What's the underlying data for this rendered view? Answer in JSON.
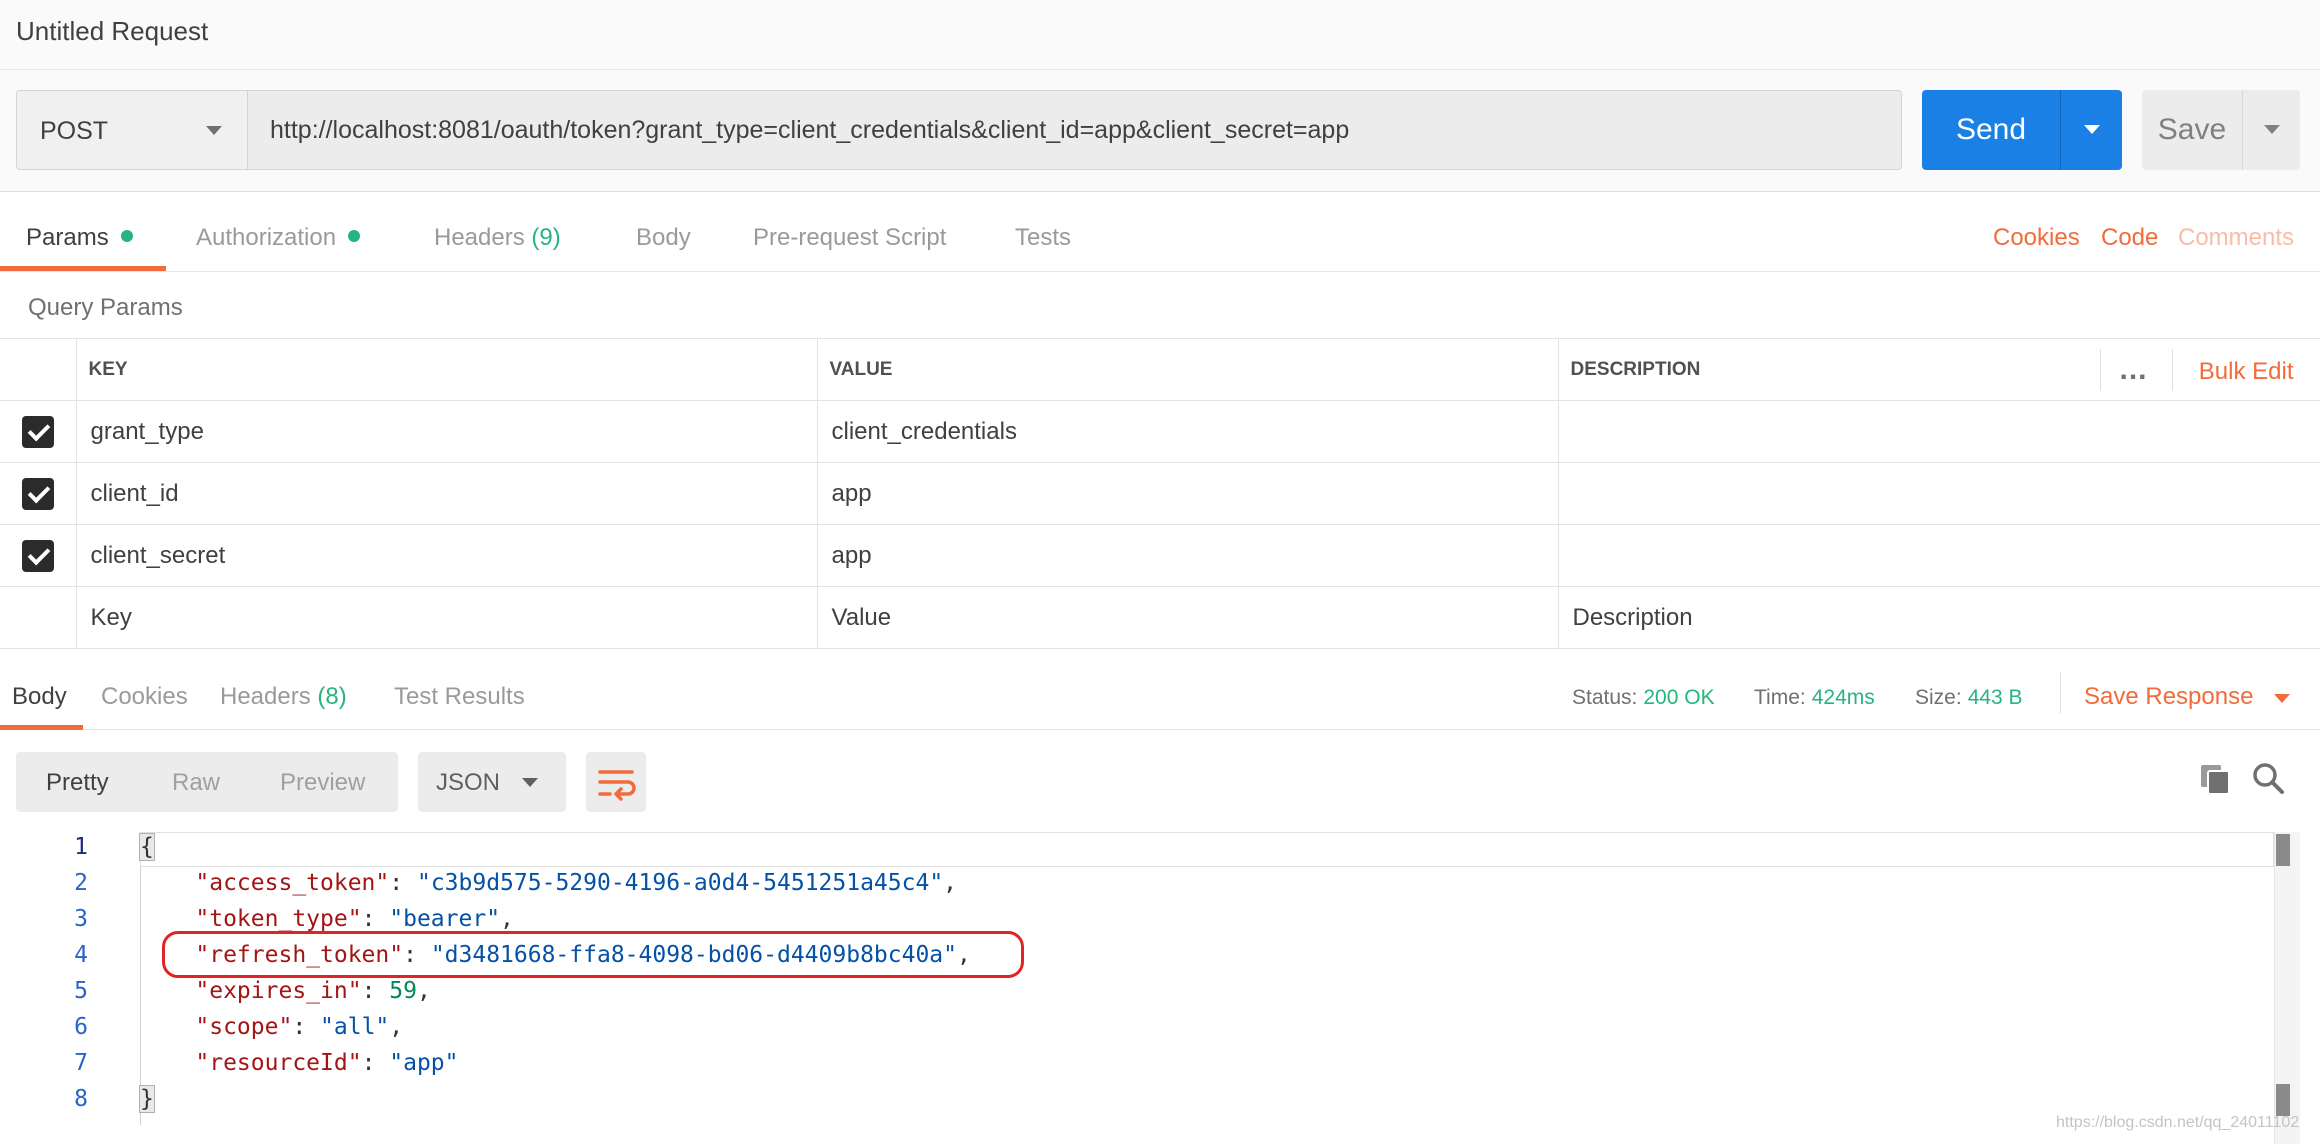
{
  "window": {
    "title": "Untitled Request"
  },
  "request": {
    "method": "POST",
    "url": "http://localhost:8081/oauth/token?grant_type=client_credentials&client_id=app&client_secret=app",
    "send_label": "Send",
    "save_label": "Save"
  },
  "request_tabs": {
    "params": "Params",
    "authorization": "Authorization",
    "headers": "Headers",
    "headers_count": "(9)",
    "body": "Body",
    "prerequest": "Pre-request Script",
    "tests": "Tests",
    "cookies": "Cookies",
    "code": "Code",
    "comments": "Comments"
  },
  "query_params": {
    "title": "Query Params",
    "columns": [
      "KEY",
      "VALUE",
      "DESCRIPTION"
    ],
    "more_icon": "...",
    "bulk_edit": "Bulk Edit",
    "rows": [
      {
        "checked": true,
        "key": "grant_type",
        "value": "client_credentials",
        "description": ""
      },
      {
        "checked": true,
        "key": "client_id",
        "value": "app",
        "description": ""
      },
      {
        "checked": true,
        "key": "client_secret",
        "value": "app",
        "description": ""
      }
    ],
    "placeholders": {
      "key": "Key",
      "value": "Value",
      "description": "Description"
    }
  },
  "response_tabs": {
    "body": "Body",
    "cookies": "Cookies",
    "headers": "Headers",
    "headers_count": "(8)",
    "test_results": "Test Results"
  },
  "response_meta": {
    "status_label": "Status:",
    "status_value": "200 OK",
    "time_label": "Time:",
    "time_value": "424ms",
    "size_label": "Size:",
    "size_value": "443 B",
    "save_response": "Save Response"
  },
  "response_view": {
    "formats": [
      "Pretty",
      "Raw",
      "Preview"
    ],
    "active_format": "Pretty",
    "language": "JSON"
  },
  "response_body": {
    "line_numbers": [
      "1",
      "2",
      "3",
      "4",
      "5",
      "6",
      "7",
      "8"
    ],
    "open_brace": "{",
    "close_brace": "}",
    "fields": [
      {
        "key": "\"access_token\"",
        "value": "\"c3b9d575-5290-4196-a0d4-5451251a45c4\"",
        "type": "string"
      },
      {
        "key": "\"token_type\"",
        "value": "\"bearer\"",
        "type": "string"
      },
      {
        "key": "\"refresh_token\"",
        "value": "\"d3481668-ffa8-4098-bd06-d4409b8bc40a\"",
        "type": "string"
      },
      {
        "key": "\"expires_in\"",
        "value": "59",
        "type": "number"
      },
      {
        "key": "\"scope\"",
        "value": "\"all\"",
        "type": "string"
      },
      {
        "key": "\"resourceId\"",
        "value": "\"app\"",
        "type": "string"
      }
    ]
  },
  "colors": {
    "accent": "#f26b3a",
    "send": "#1a80e6",
    "success": "#26b47f",
    "json_key": "#a31515",
    "json_string": "#0451a5",
    "json_number": "#098658",
    "highlight": "#e02424"
  },
  "watermark": "https://blog.csdn.net/qq_24011102"
}
